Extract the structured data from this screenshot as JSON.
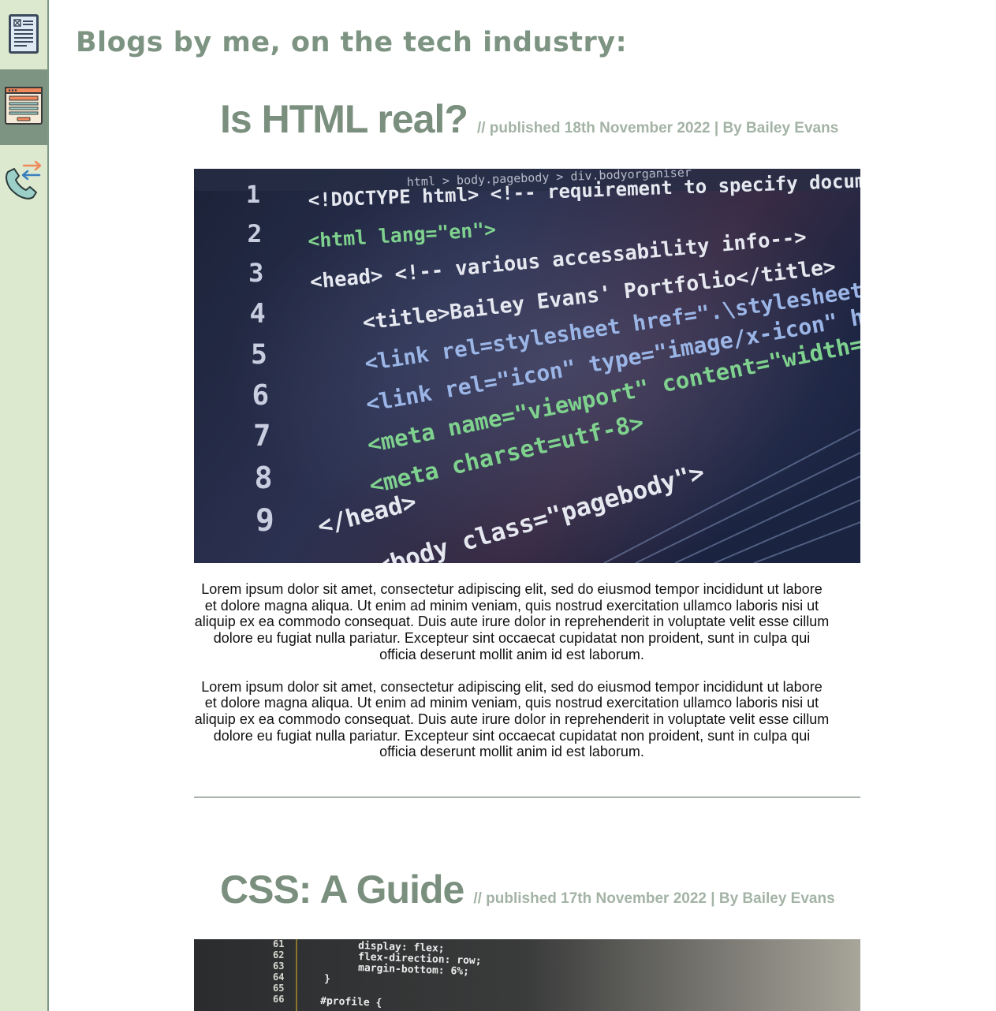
{
  "sidebar": {
    "items": [
      {
        "name": "document-icon",
        "active": false
      },
      {
        "name": "webpage-icon",
        "active": true
      },
      {
        "name": "phone-transfer-icon",
        "active": false
      }
    ]
  },
  "page": {
    "heading": "Blogs by me, on the tech industry:"
  },
  "posts": [
    {
      "title": "Is HTML real?",
      "meta": "// published 18th November 2022 | By Bailey Evans",
      "paragraphs": [
        "Lorem ipsum dolor sit amet, consectetur adipiscing elit, sed do eiusmod tempor incididunt ut labore et dolore magna aliqua. Ut enim ad minim veniam, quis nostrud exercitation ullamco laboris nisi ut aliquip ex ea commodo consequat. Duis aute irure dolor in reprehenderit in voluptate velit esse cillum dolore eu fugiat nulla pariatur. Excepteur sint occaecat cupidatat non proident, sunt in culpa qui officia deserunt mollit anim id est laborum.",
        "Lorem ipsum dolor sit amet, consectetur adipiscing elit, sed do eiusmod tempor incididunt ut labore et dolore magna aliqua. Ut enim ad minim veniam, quis nostrud exercitation ullamco laboris nisi ut aliquip ex ea commodo consequat. Duis aute irure dolor in reprehenderit in voluptate velit esse cillum dolore eu fugiat nulla pariatur. Excepteur sint occaecat cupidatat non proident, sunt in culpa qui officia deserunt mollit anim id est laborum."
      ],
      "image_code": {
        "line_numbers": [
          "1",
          "2",
          "3",
          "4",
          "5",
          "6",
          "7",
          "8",
          "9"
        ],
        "lines": [
          "<!DOCTYPE html> <!-- requirement to specify document type -->",
          "<html lang=\"en\">",
          "<head> <!-- various accessability info-->",
          "<title>Bailey Evans' Portfolio</title>",
          "<link rel=stylesheet href=\".\\stylesheets\\main.css\">",
          "<link rel=\"icon\" type=\"image/x-icon\" href=",
          "<meta name=\"viewport\" content=\"width=device-width",
          "<meta charset=utf-8>",
          "</head>",
          "<body class=\"pagebody\">"
        ],
        "breadcrumb": "html > body.pagebody > div.bodyorganiser"
      }
    },
    {
      "title": "CSS: A Guide",
      "meta": "// published 17th November 2022 | By Bailey Evans",
      "image_code": {
        "line_numbers": [
          "61",
          "62",
          "63",
          "64",
          "65",
          "66"
        ],
        "lines": [
          "display: flex;",
          "flex-direction: row;",
          "margin-bottom: 6%;",
          "}",
          "",
          "#profile {"
        ]
      }
    }
  ],
  "colors": {
    "accent": "#7e9483",
    "sidebar_bg": "#dde9cf",
    "meta_text": "#a3b3a5",
    "divider": "#a7b2a9"
  }
}
